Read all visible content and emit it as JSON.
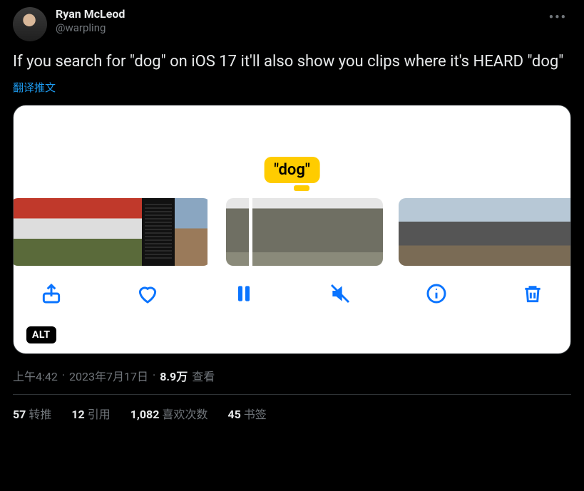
{
  "author": {
    "display_name": "Ryan McLeod",
    "handle": "@warpling"
  },
  "tweet": {
    "text": "If you search for \"dog\" on iOS 17 it'll also show you clips where it's HEARD \"dog\"",
    "translate_label": "翻译推文"
  },
  "media": {
    "bubble_text": "\"dog\"",
    "alt_badge": "ALT"
  },
  "meta": {
    "time": "上午4:42",
    "date": "2023年7月17日",
    "views_number": "8.9万",
    "views_label": "查看"
  },
  "stats": {
    "retweets": {
      "count": "57",
      "label": "转推"
    },
    "quotes": {
      "count": "12",
      "label": "引用"
    },
    "likes": {
      "count": "1,082",
      "label": "喜欢次数"
    },
    "bookmarks": {
      "count": "45",
      "label": "书签"
    }
  }
}
